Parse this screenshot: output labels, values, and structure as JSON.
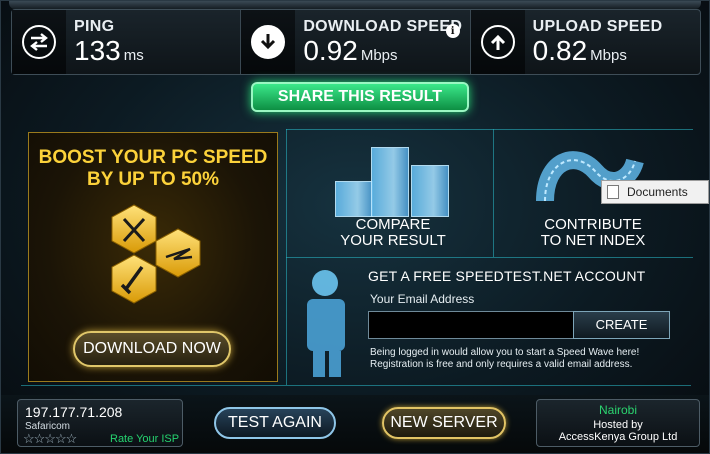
{
  "stats": {
    "ping": {
      "label": "PING",
      "value": "133",
      "unit": "ms",
      "icon": "swap-arrows-icon"
    },
    "download": {
      "label": "DOWNLOAD SPEED",
      "value": "0.92",
      "unit": "Mbps",
      "icon": "download-arrow-icon",
      "info_icon": "info-icon"
    },
    "upload": {
      "label": "UPLOAD SPEED",
      "value": "0.82",
      "unit": "Mbps",
      "icon": "upload-arrow-icon"
    }
  },
  "share": {
    "label": "SHARE THIS RESULT"
  },
  "boost": {
    "title_line1": "BOOST YOUR PC SPEED",
    "title_line2": "BY UP TO 50%",
    "button": "DOWNLOAD NOW",
    "accent": "#fcd23a"
  },
  "compare": {
    "line1": "COMPARE",
    "line2": "YOUR RESULT"
  },
  "contribute": {
    "line1": "CONTRIBUTE",
    "line2": "TO NET INDEX"
  },
  "tooltip": {
    "label": "Documents"
  },
  "account": {
    "title": "GET A FREE SPEEDTEST.NET ACCOUNT",
    "email_label": "Your Email Address",
    "email_value": "",
    "create_button": "CREATE",
    "note_line1": "Being logged in would allow you to start a Speed Wave here!",
    "note_line2": "Registration is free and only requires a valid email address."
  },
  "isp": {
    "ip": "197.177.71.208",
    "name": "Safaricom",
    "rating": 0,
    "rating_max": 5,
    "rate_label": "Rate Your ISP"
  },
  "buttons": {
    "test_again": "TEST AGAIN",
    "new_server": "NEW SERVER"
  },
  "server": {
    "city": "Nairobi",
    "hosted_label": "Hosted by",
    "host": "AccessKenya Group Ltd"
  },
  "colors": {
    "share_green": "#27d775",
    "grid_cyan": "#2ab9c9",
    "gold": "#e0c76a",
    "link_green": "#25d36f"
  }
}
